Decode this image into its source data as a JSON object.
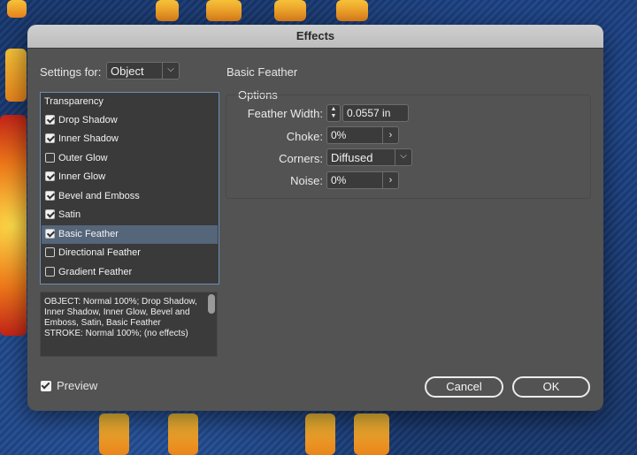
{
  "dialog": {
    "title": "Effects"
  },
  "settings_for": {
    "label": "Settings for:",
    "value": "Object"
  },
  "effects_list": {
    "header": "Transparency",
    "items": [
      {
        "label": "Drop Shadow",
        "checked": true
      },
      {
        "label": "Inner Shadow",
        "checked": true
      },
      {
        "label": "Outer Glow",
        "checked": false
      },
      {
        "label": "Inner Glow",
        "checked": true
      },
      {
        "label": "Bevel and Emboss",
        "checked": true
      },
      {
        "label": "Satin",
        "checked": true
      },
      {
        "label": "Basic Feather",
        "checked": true,
        "selected": true
      },
      {
        "label": "Directional Feather",
        "checked": false
      },
      {
        "label": "Gradient Feather",
        "checked": false
      }
    ]
  },
  "summary": {
    "line1": "OBJECT: Normal 100%; Drop Shadow,",
    "line2": "Inner Shadow, Inner Glow, Bevel and",
    "line3": "Emboss, Satin, Basic Feather",
    "line4": "STROKE: Normal 100%; (no effects)"
  },
  "panel": {
    "title": "Basic Feather",
    "group_label": "Options",
    "feather_width": {
      "label": "Feather Width:",
      "value": "0.0557 in"
    },
    "choke": {
      "label": "Choke:",
      "value": "0%"
    },
    "corners": {
      "label": "Corners:",
      "value": "Diffused"
    },
    "noise": {
      "label": "Noise:",
      "value": "0%"
    }
  },
  "preview": {
    "label": "Preview",
    "checked": true
  },
  "buttons": {
    "cancel": "Cancel",
    "ok": "OK"
  }
}
